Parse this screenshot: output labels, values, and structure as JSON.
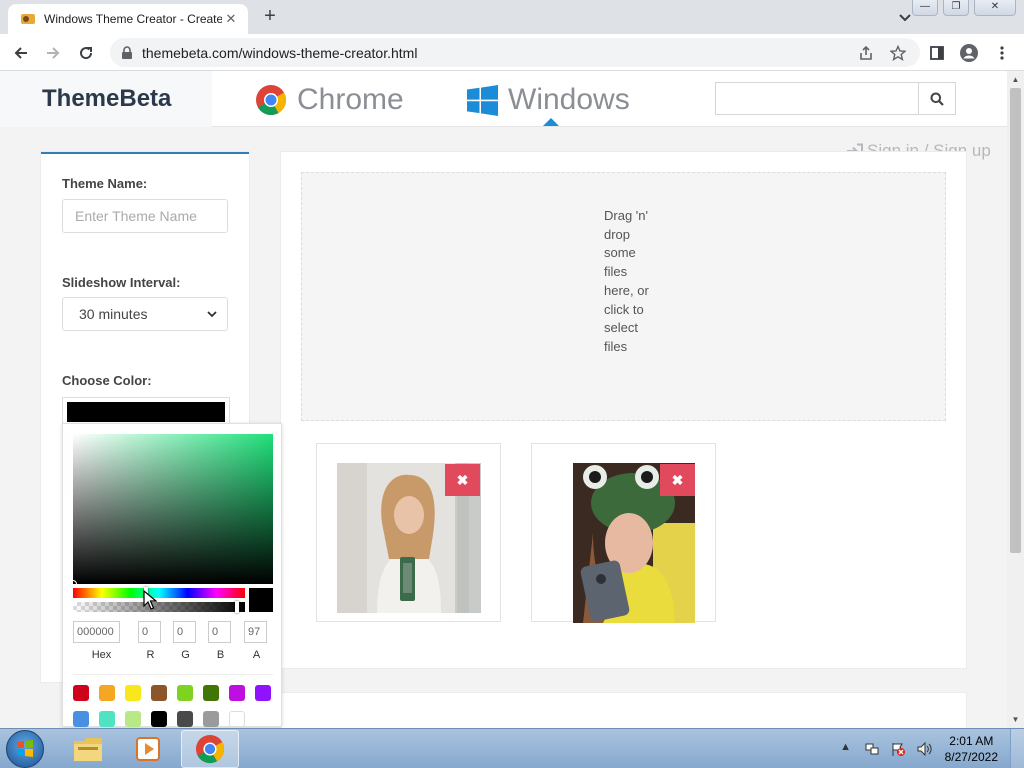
{
  "browser": {
    "tab_title": "Windows Theme Creator - Create",
    "tab_close": "✕",
    "new_tab": "+",
    "url": "themebeta.com/windows-theme-creator.html",
    "window_buttons": {
      "minimize": "—",
      "restore": "❐",
      "close": "✕"
    }
  },
  "site": {
    "brand": "ThemeBeta",
    "nav": [
      {
        "label": "Chrome",
        "icon": "chrome-icon"
      },
      {
        "label": "Windows",
        "icon": "windows-icon",
        "active": true
      }
    ],
    "search": {
      "placeholder": "",
      "value": ""
    },
    "signin": "Sign in / Sign up"
  },
  "sidebar": {
    "theme_name_label": "Theme Name:",
    "theme_name_placeholder": "Enter Theme Name",
    "slideshow_label": "Slideshow Interval:",
    "slideshow_value": "30 minutes",
    "color_label": "Choose Color:",
    "selected_color": "#000000"
  },
  "color_picker": {
    "hue_color": "#1fe07a",
    "fields": [
      {
        "label": "Hex",
        "value": "000000"
      },
      {
        "label": "R",
        "value": "0"
      },
      {
        "label": "G",
        "value": "0"
      },
      {
        "label": "B",
        "value": "0"
      },
      {
        "label": "A",
        "value": "97"
      }
    ],
    "presets": [
      "#d0021b",
      "#f5a623",
      "#f8e71c",
      "#8b572a",
      "#7ed321",
      "#417505",
      "#bd10e0",
      "#9013fe",
      "#4a90e2",
      "#50e3c2",
      "#b8e986",
      "#000000",
      "#4a4a4a",
      "#9b9b9b",
      "#ffffff"
    ]
  },
  "upload": {
    "dropzone_text": "Drag 'n' drop some files here, or click to select files",
    "delete_label": "✖",
    "images": [
      {
        "alt": "uploaded-photo-1"
      },
      {
        "alt": "uploaded-photo-2"
      }
    ]
  },
  "taskbar": {
    "clock_time": "2:01 AM",
    "clock_date": "8/27/2022",
    "apps": [
      "file-explorer-icon",
      "media-player-icon",
      "chrome-icon"
    ]
  }
}
